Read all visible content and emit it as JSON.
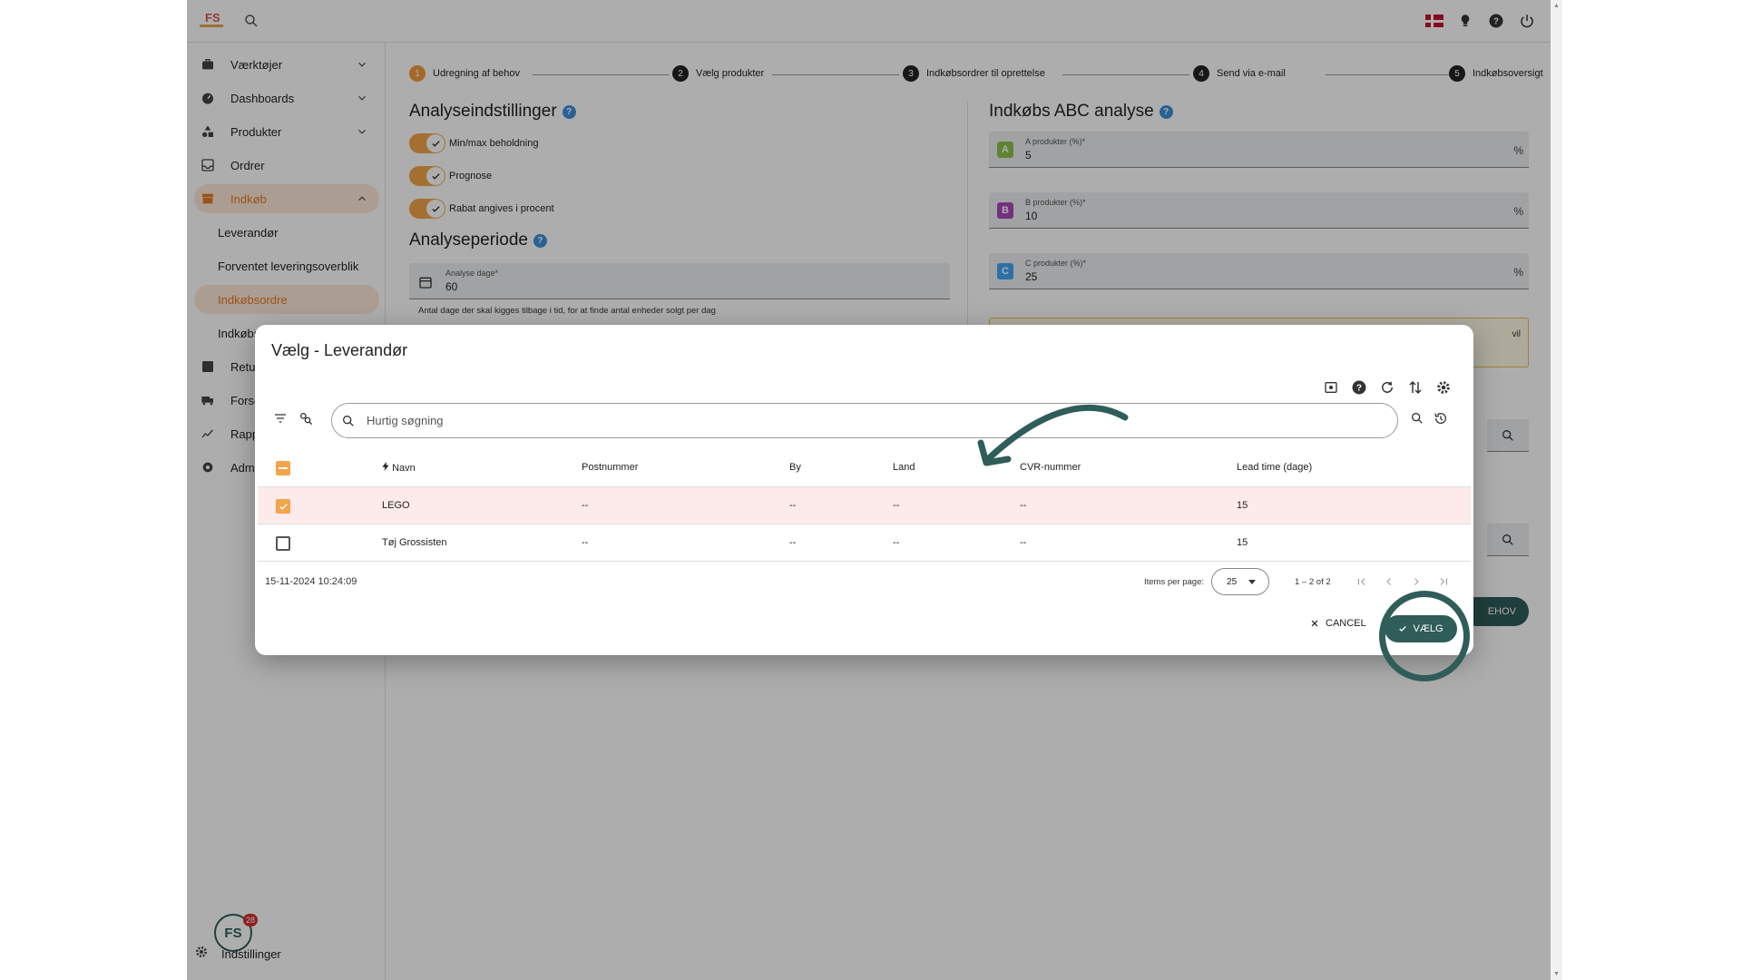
{
  "header": {
    "logo_text": "FS",
    "flag": "danish-flag"
  },
  "sidebar": {
    "items": [
      {
        "label": "Værktøjer",
        "icon": "briefcase-icon"
      },
      {
        "label": "Dashboards",
        "icon": "gauge-icon"
      },
      {
        "label": "Produkter",
        "icon": "shapes-icon"
      },
      {
        "label": "Ordrer",
        "icon": "inbox-icon"
      },
      {
        "label": "Indkøb",
        "icon": "store-icon"
      },
      {
        "label": "Retur",
        "icon": "return-icon"
      },
      {
        "label": "Forse",
        "icon": "truck-icon"
      },
      {
        "label": "Rapp",
        "icon": "chart-icon"
      },
      {
        "label": "Admi",
        "icon": "admin-icon"
      }
    ],
    "sub_items": [
      {
        "label": "Leverandør"
      },
      {
        "label": "Forventet leveringsoverblik"
      },
      {
        "label": "Indkøbsordre"
      },
      {
        "label": "Indkøbs"
      }
    ],
    "badge_count": "28",
    "settings_label": "Indstillinger"
  },
  "stepper": {
    "steps": [
      {
        "num": "1",
        "label": "Udregning af behov"
      },
      {
        "num": "2",
        "label": "Vælg produkter"
      },
      {
        "num": "3",
        "label": "Indkøbsordrer til oprettelse"
      },
      {
        "num": "4",
        "label": "Send via e-mail"
      },
      {
        "num": "5",
        "label": "Indkøbsoversigt"
      }
    ]
  },
  "analysis": {
    "settings_title": "Analyseindstillinger",
    "toggles": [
      {
        "label": "Min/max beholdning",
        "on": true
      },
      {
        "label": "Prognose",
        "on": true
      },
      {
        "label": "Rabat angives i procent",
        "on": true
      }
    ],
    "period_title": "Analyseperiode",
    "days_label": "Analyse dage*",
    "days_value": "60",
    "days_hint": "Antal dage der skal kigges tilbage i tid, for at finde antal enheder solgt per dag"
  },
  "abc": {
    "title": "Indkøbs ABC analyse",
    "fields": [
      {
        "letter": "A",
        "label": "A produkter (%)*",
        "value": "5",
        "unit": "%",
        "color": "#8bc34a"
      },
      {
        "letter": "B",
        "label": "B produkter (%)*",
        "value": "10",
        "unit": "%",
        "color": "#ab47bc"
      },
      {
        "letter": "C",
        "label": "C produkter (%)*",
        "value": "25",
        "unit": "%",
        "color": "#42a5f5"
      }
    ],
    "warn_text": "vil",
    "behov_button": "EHOV"
  },
  "dialog": {
    "title": "Vælg - Leverandør",
    "search_placeholder": "Hurtig søgning",
    "columns": [
      "Navn",
      "Postnummer",
      "By",
      "Land",
      "CVR-nummer",
      "Lead time (dage)"
    ],
    "rows": [
      {
        "selected": true,
        "navn": "LEGO",
        "postnummer": "--",
        "by": "--",
        "land": "--",
        "cvr": "--",
        "lead": "15"
      },
      {
        "selected": false,
        "navn": "Tøj Grossisten",
        "postnummer": "--",
        "by": "--",
        "land": "--",
        "cvr": "--",
        "lead": "15"
      }
    ],
    "timestamp": "15-11-2024 10:24:09",
    "items_per_page_label": "Items per page:",
    "items_per_page": "25",
    "range": "1 – 2 of 2",
    "cancel_label": "CANCEL",
    "select_label": "VÆLG"
  },
  "colors": {
    "accent": "#f2a54a",
    "primary": "#2f5d59",
    "selected_row": "#fdeaea"
  }
}
